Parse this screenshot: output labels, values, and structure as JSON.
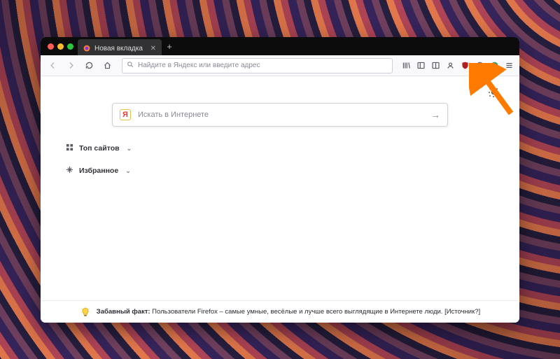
{
  "tab": {
    "title": "Новая вкладка"
  },
  "urlbar": {
    "placeholder": "Найдите в Яндекс или введите адрес"
  },
  "search": {
    "placeholder": "Искать в Интернете",
    "engine_letter": "Я"
  },
  "sections": {
    "topsites": "Топ сайтов",
    "highlights": "Избранное"
  },
  "snippet": {
    "label": "Забавный факт:",
    "text": "Пользователи Firefox – самые умные, весёлые и лучше всего выглядящие в Интернете люди.",
    "source": "[Источник?]"
  },
  "toolbar_icons": {
    "back": "back-icon",
    "forward": "forward-icon",
    "reload": "reload-icon",
    "home": "home-icon",
    "library": "library-icon",
    "sidebar": "sidebar-icon",
    "account": "account-icon",
    "ublock": "ublock-icon",
    "noscript": "noscript-icon",
    "privacy": "privacy-icon",
    "menu": "hamburger-menu-icon",
    "newtab_gear": "gear-icon"
  }
}
